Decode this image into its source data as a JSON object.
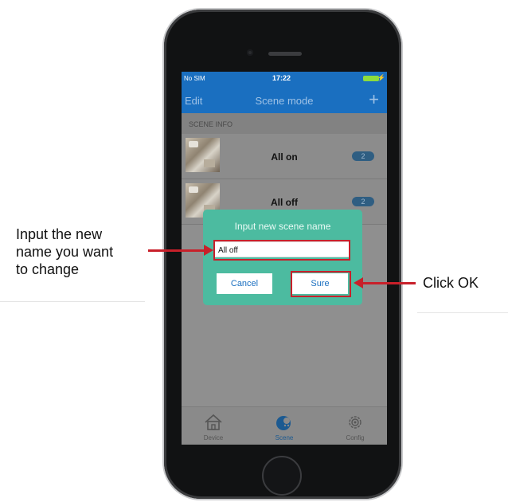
{
  "status_bar": {
    "carrier": "No SIM",
    "time": "17:22"
  },
  "nav_bar": {
    "edit_label": "Edit",
    "title": "Scene mode",
    "add_label": "+"
  },
  "section": {
    "header": "SCENE INFO"
  },
  "scenes": [
    {
      "name": "All on",
      "count": "2"
    },
    {
      "name": "All off",
      "count": "2"
    }
  ],
  "tab_bar": {
    "items": [
      {
        "label": "Device",
        "icon": "home-icon"
      },
      {
        "label": "Scene",
        "icon": "scene-icon"
      },
      {
        "label": "Config",
        "icon": "gear-icon"
      }
    ]
  },
  "dialog": {
    "title": "Input new scene name",
    "input_value": "All off",
    "cancel_label": "Cancel",
    "sure_label": "Sure"
  },
  "annotations": {
    "left_text": [
      "Input the new",
      "name you want",
      "to change"
    ],
    "right_text": "Click OK",
    "highlight_color": "#c8202a"
  },
  "colors": {
    "nav_blue": "#1a6fc0",
    "dialog_green": "#4cbba0",
    "overlay_gray": "#8f8f8f"
  }
}
